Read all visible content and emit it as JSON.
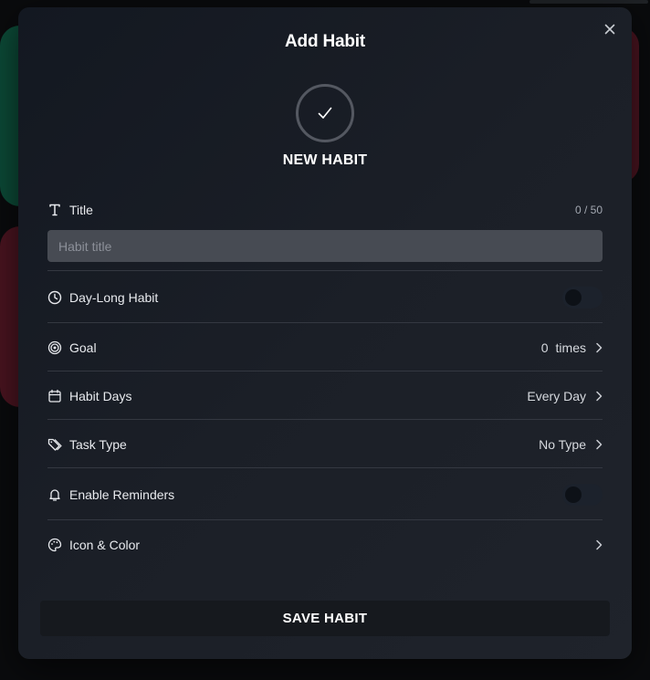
{
  "modal": {
    "title": "Add Habit",
    "habit_name": "NEW HABIT",
    "habit_icon": "checkmark-icon"
  },
  "title_field": {
    "label": "Title",
    "counter": "0 / 50",
    "placeholder": "Habit title",
    "value": ""
  },
  "rows": {
    "day_long": {
      "label": "Day-Long Habit",
      "enabled": false,
      "icon": "clock-icon"
    },
    "goal": {
      "label": "Goal",
      "count": "0",
      "unit": "times",
      "icon": "target-icon"
    },
    "habit_days": {
      "label": "Habit Days",
      "value": "Every Day",
      "icon": "calendar-icon"
    },
    "task_type": {
      "label": "Task Type",
      "value": "No Type",
      "icon": "tag-icon"
    },
    "reminders": {
      "label": "Enable Reminders",
      "enabled": false,
      "icon": "bell-icon"
    },
    "icon_color": {
      "label": "Icon & Color",
      "icon": "palette-icon"
    }
  },
  "save_button": {
    "label": "SAVE HABIT"
  },
  "colors": {
    "modal_bg": "#1b1f27",
    "input_bg": "#474b53",
    "divider": "#343841",
    "toggle_off": "#1c222c",
    "save_bg": "#16191e",
    "accent_green": "#0c4a37",
    "accent_red": "#4a1420"
  }
}
